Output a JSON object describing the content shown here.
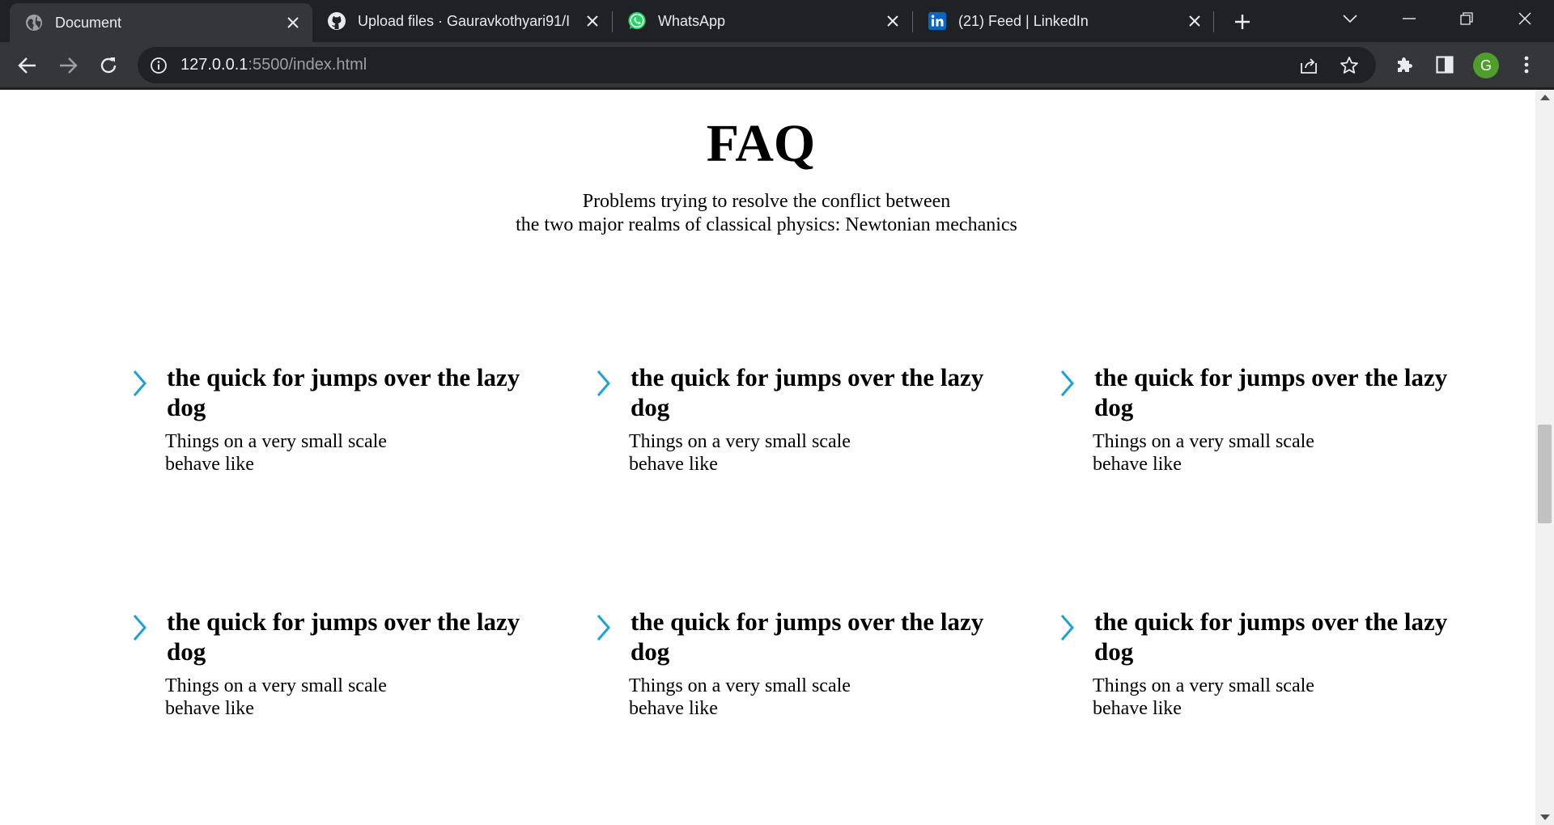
{
  "browser": {
    "tabs": [
      {
        "title": "Document",
        "icon": "globe-icon",
        "active": true
      },
      {
        "title": "Upload files · Gauravkothyari91/I",
        "icon": "github-icon",
        "active": false
      },
      {
        "title": "WhatsApp",
        "icon": "whatsapp-icon",
        "active": false
      },
      {
        "title": "(21) Feed | LinkedIn",
        "icon": "linkedin-icon",
        "active": false
      }
    ],
    "url_host": "127.0.0.1",
    "url_path": ":5500/index.html",
    "profile_initial": "G",
    "colors": {
      "tabstrip": "#202124",
      "toolbar": "#35363a",
      "avatar": "#4f9d2a",
      "accent": "#1da1d6"
    }
  },
  "page": {
    "title": "FAQ",
    "subtitle_lines": [
      "Problems trying to resolve the conflict between",
      "the two major realms of classical physics: Newtonian mechanics"
    ],
    "items": [
      {
        "question": "the quick for jumps over the lazy dog",
        "answer": "Things on a very small scale behave like"
      },
      {
        "question": "the quick for jumps over the lazy dog",
        "answer": "Things on a very small scale behave like"
      },
      {
        "question": "the quick for jumps over the lazy dog",
        "answer": "Things on a very small scale behave like"
      },
      {
        "question": "the quick for jumps over the lazy dog",
        "answer": "Things on a very small scale behave like"
      },
      {
        "question": "the quick for jumps over the lazy dog",
        "answer": "Things on a very small scale behave like"
      },
      {
        "question": "the quick for jumps over the lazy dog",
        "answer": "Things on a very small scale behave like"
      }
    ]
  }
}
